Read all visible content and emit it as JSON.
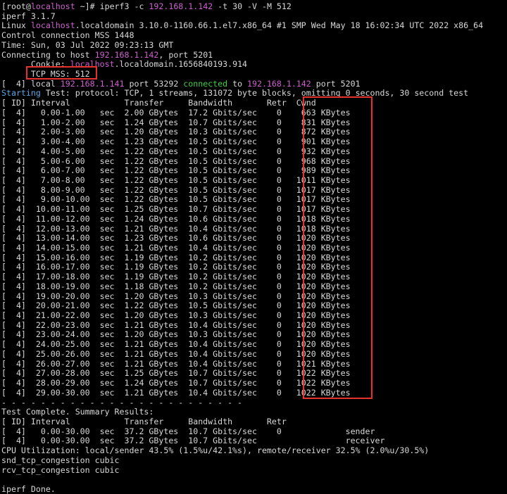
{
  "terminal": {
    "lines": [
      {
        "segments": [
          {
            "text": "[root@"
          },
          {
            "text": "localhost",
            "color": "#cf5fd0"
          },
          {
            "text": " ~]# iperf3 -c "
          },
          {
            "text": "192.168.1.142",
            "color": "#cf5fd0"
          },
          {
            "text": " -t 30 -V -M 512"
          }
        ]
      },
      {
        "segments": [
          {
            "text": "iperf 3.1.7"
          }
        ]
      },
      {
        "segments": [
          {
            "text": "Linux "
          },
          {
            "text": "localhost",
            "color": "#cf5fd0"
          },
          {
            "text": ".localdomain 3.10.0-1160.66.1.el7.x86_64 #1 SMP Wed May 18 16:02:34 UTC 2022 x86_64"
          }
        ]
      },
      {
        "segments": [
          {
            "text": "Control connection MSS 1448"
          }
        ]
      },
      {
        "segments": [
          {
            "text": "Time: Sun, 03 Jul 2022 09:23:13 GMT"
          }
        ]
      },
      {
        "segments": [
          {
            "text": "Connecting to host "
          },
          {
            "text": "192.168.1.142",
            "color": "#cf5fd0"
          },
          {
            "text": ", port 5201"
          }
        ]
      },
      {
        "segments": [
          {
            "text": "      Cookie: "
          },
          {
            "text": "localhost",
            "color": "#cf5fd0"
          },
          {
            "text": ".localdomain.1656840193.914"
          }
        ]
      },
      {
        "segments": [
          {
            "text": "      TCP MSS: 512"
          }
        ]
      },
      {
        "segments": [
          {
            "text": "[  4] local "
          },
          {
            "text": "192.168.1.141",
            "color": "#cf5fd0"
          },
          {
            "text": " port 53292 "
          },
          {
            "text": "connected",
            "color": "#3fcf3f"
          },
          {
            "text": " to "
          },
          {
            "text": "192.168.1.142",
            "color": "#cf5fd0"
          },
          {
            "text": " port 5201"
          }
        ]
      },
      {
        "segments": [
          {
            "text": "Starting",
            "color": "#5aa8e8"
          },
          {
            "text": " Test: protocol: TCP, 1 streams, 131072 byte blocks, omitting 0 seconds, 30 second test"
          }
        ]
      },
      {
        "segments": [
          {
            "text": "[ ID] Interval           Transfer     Bandwidth       Retr  Cwnd"
          }
        ]
      },
      {
        "segments": [
          {
            "text": "[  4]   0.00-1.00   sec  2.00 GBytes  17.2 Gbits/sec    0    663 KBytes"
          }
        ]
      },
      {
        "segments": [
          {
            "text": "[  4]   1.00-2.00   sec  1.24 GBytes  10.7 Gbits/sec    0    831 KBytes"
          }
        ]
      },
      {
        "segments": [
          {
            "text": "[  4]   2.00-3.00   sec  1.20 GBytes  10.3 Gbits/sec    0    872 KBytes"
          }
        ]
      },
      {
        "segments": [
          {
            "text": "[  4]   3.00-4.00   sec  1.23 GBytes  10.5 Gbits/sec    0    901 KBytes"
          }
        ]
      },
      {
        "segments": [
          {
            "text": "[  4]   4.00-5.00   sec  1.22 GBytes  10.5 Gbits/sec    0    932 KBytes"
          }
        ]
      },
      {
        "segments": [
          {
            "text": "[  4]   5.00-6.00   sec  1.22 GBytes  10.5 Gbits/sec    0    968 KBytes"
          }
        ]
      },
      {
        "segments": [
          {
            "text": "[  4]   6.00-7.00   sec  1.22 GBytes  10.5 Gbits/sec    0    989 KBytes"
          }
        ]
      },
      {
        "segments": [
          {
            "text": "[  4]   7.00-8.00   sec  1.22 GBytes  10.5 Gbits/sec    0   1011 KBytes"
          }
        ]
      },
      {
        "segments": [
          {
            "text": "[  4]   8.00-9.00   sec  1.22 GBytes  10.5 Gbits/sec    0   1017 KBytes"
          }
        ]
      },
      {
        "segments": [
          {
            "text": "[  4]   9.00-10.00  sec  1.22 GBytes  10.5 Gbits/sec    0   1017 KBytes"
          }
        ]
      },
      {
        "segments": [
          {
            "text": "[  4]  10.00-11.00  sec  1.25 GBytes  10.7 Gbits/sec    0   1017 KBytes"
          }
        ]
      },
      {
        "segments": [
          {
            "text": "[  4]  11.00-12.00  sec  1.24 GBytes  10.6 Gbits/sec    0   1018 KBytes"
          }
        ]
      },
      {
        "segments": [
          {
            "text": "[  4]  12.00-13.00  sec  1.21 GBytes  10.4 Gbits/sec    0   1018 KBytes"
          }
        ]
      },
      {
        "segments": [
          {
            "text": "[  4]  13.00-14.00  sec  1.23 GBytes  10.6 Gbits/sec    0   1020 KBytes"
          }
        ]
      },
      {
        "segments": [
          {
            "text": "[  4]  14.00-15.00  sec  1.21 GBytes  10.4 Gbits/sec    0   1020 KBytes"
          }
        ]
      },
      {
        "segments": [
          {
            "text": "[  4]  15.00-16.00  sec  1.19 GBytes  10.2 Gbits/sec    0   1020 KBytes"
          }
        ]
      },
      {
        "segments": [
          {
            "text": "[  4]  16.00-17.00  sec  1.19 GBytes  10.2 Gbits/sec    0   1020 KBytes"
          }
        ]
      },
      {
        "segments": [
          {
            "text": "[  4]  17.00-18.00  sec  1.19 GBytes  10.2 Gbits/sec    0   1020 KBytes"
          }
        ]
      },
      {
        "segments": [
          {
            "text": "[  4]  18.00-19.00  sec  1.18 GBytes  10.2 Gbits/sec    0   1020 KBytes"
          }
        ]
      },
      {
        "segments": [
          {
            "text": "[  4]  19.00-20.00  sec  1.20 GBytes  10.3 Gbits/sec    0   1020 KBytes"
          }
        ]
      },
      {
        "segments": [
          {
            "text": "[  4]  20.00-21.00  sec  1.22 GBytes  10.5 Gbits/sec    0   1020 KBytes"
          }
        ]
      },
      {
        "segments": [
          {
            "text": "[  4]  21.00-22.00  sec  1.20 GBytes  10.3 Gbits/sec    0   1020 KBytes"
          }
        ]
      },
      {
        "segments": [
          {
            "text": "[  4]  22.00-23.00  sec  1.21 GBytes  10.4 Gbits/sec    0   1020 KBytes"
          }
        ]
      },
      {
        "segments": [
          {
            "text": "[  4]  23.00-24.00  sec  1.20 GBytes  10.3 Gbits/sec    0   1020 KBytes"
          }
        ]
      },
      {
        "segments": [
          {
            "text": "[  4]  24.00-25.00  sec  1.21 GBytes  10.4 Gbits/sec    0   1020 KBytes"
          }
        ]
      },
      {
        "segments": [
          {
            "text": "[  4]  25.00-26.00  sec  1.21 GBytes  10.4 Gbits/sec    0   1020 KBytes"
          }
        ]
      },
      {
        "segments": [
          {
            "text": "[  4]  26.00-27.00  sec  1.21 GBytes  10.4 Gbits/sec    0   1021 KBytes"
          }
        ]
      },
      {
        "segments": [
          {
            "text": "[  4]  27.00-28.00  sec  1.25 GBytes  10.7 Gbits/sec    0   1022 KBytes"
          }
        ]
      },
      {
        "segments": [
          {
            "text": "[  4]  28.00-29.00  sec  1.24 GBytes  10.7 Gbits/sec    0   1022 KBytes"
          }
        ]
      },
      {
        "segments": [
          {
            "text": "[  4]  29.00-30.00  sec  1.21 GBytes  10.4 Gbits/sec    0   1022 KBytes"
          }
        ]
      },
      {
        "segments": [
          {
            "text": "- - - - - - - - - - - - - - - - - - - - - - - - -"
          }
        ]
      },
      {
        "segments": [
          {
            "text": "Test Complete. Summary Results:"
          }
        ]
      },
      {
        "segments": [
          {
            "text": "[ ID] Interval           Transfer     Bandwidth       Retr"
          }
        ]
      },
      {
        "segments": [
          {
            "text": "[  4]   0.00-30.00  sec  37.2 GBytes  10.7 Gbits/sec    0             sender"
          }
        ]
      },
      {
        "segments": [
          {
            "text": "[  4]   0.00-30.00  sec  37.2 GBytes  10.7 Gbits/sec                  receiver"
          }
        ]
      },
      {
        "segments": [
          {
            "text": "CPU Utilization: local/sender 43.5% (1.5%u/42.1%s), remote/receiver 32.5% (2.0%u/30.5%)"
          }
        ]
      },
      {
        "segments": [
          {
            "text": "snd_tcp_congestion cubic"
          }
        ]
      },
      {
        "segments": [
          {
            "text": "rcv_tcp_congestion cubic"
          }
        ]
      },
      {
        "segments": [
          {
            "text": ""
          }
        ]
      },
      {
        "segments": [
          {
            "text": "iperf Done."
          }
        ]
      }
    ]
  },
  "colors": {
    "background": "#000000",
    "text": "#d8d8d8",
    "host_magenta": "#cf5fd0",
    "connected_green": "#3fcf3f",
    "starting_blue": "#5aa8e8",
    "highlight_red": "#e8312f"
  }
}
